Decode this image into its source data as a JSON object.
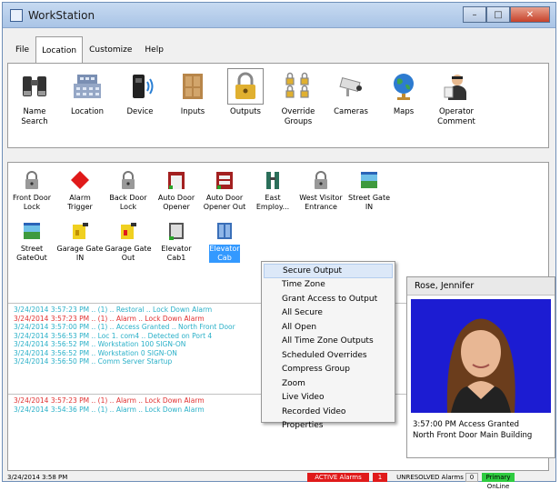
{
  "window": {
    "title": "WorkStation"
  },
  "menu": {
    "tabs": [
      "File",
      "Location",
      "Customize",
      "Help"
    ],
    "active": "Location"
  },
  "ribbon": {
    "items": [
      {
        "label": "Name\nSearch",
        "icon": "binoculars-icon"
      },
      {
        "label": "Location",
        "icon": "building-icon"
      },
      {
        "label": "Device",
        "icon": "device-icon"
      },
      {
        "label": "Inputs",
        "icon": "door-icon"
      },
      {
        "label": "Outputs",
        "icon": "padlock-icon"
      },
      {
        "label": "Override\nGroups",
        "icon": "lock-group-icon"
      },
      {
        "label": "Cameras",
        "icon": "camera-icon"
      },
      {
        "label": "Maps",
        "icon": "globe-icon"
      },
      {
        "label": "Operator\nComment",
        "icon": "operator-icon"
      }
    ]
  },
  "devices": [
    {
      "label": "Front Door\nLock",
      "icon": "lock-icon"
    },
    {
      "label": "Alarm\nTrigger",
      "icon": "alarm-diamond-icon"
    },
    {
      "label": "Back Door\nLock",
      "icon": "lock-icon"
    },
    {
      "label": "Auto Door\nOpener",
      "icon": "auto-door-icon"
    },
    {
      "label": "Auto Door\nOpener Out",
      "icon": "auto-door-icon"
    },
    {
      "label": "East\nEmploy...",
      "icon": "turnstile-icon"
    },
    {
      "label": "West Visitor\nEntrance",
      "icon": "lock-icon"
    },
    {
      "label": "Street Gate\nIN",
      "icon": "gate-icon"
    },
    {
      "label": "Street\nGateOut",
      "icon": "gate-icon"
    },
    {
      "label": "Garage Gate\nIN",
      "icon": "garage-gate-icon"
    },
    {
      "label": "Garage Gate\nOut",
      "icon": "garage-gate-icon"
    },
    {
      "label": "Elevator\nCab1",
      "icon": "elevator-icon"
    },
    {
      "label": "Elevator\nCab",
      "icon": "elevator-icon"
    }
  ],
  "log_top": [
    {
      "text": "3/24/2014 3:57:23 PM .. (1) .. Restoral .. Lock Down Alarm",
      "color": "cyan"
    },
    {
      "text": "3/24/2014 3:57:23 PM .. (1) .. Alarm .. Lock Down Alarm",
      "color": "red"
    },
    {
      "text": "3/24/2014 3:57:00 PM .. (1) .. Access Granted .. North Front Door",
      "color": "cyan"
    },
    {
      "text": "3/24/2014 3:56:53 PM .. Loc 1. com4 .. Detected on Port 4",
      "color": "cyan"
    },
    {
      "text": "3/24/2014 3:56:52 PM .. Workstation 100 SIGN-ON",
      "color": "cyan"
    },
    {
      "text": "3/24/2014 3:56:52 PM .. Workstation 0 SIGN-ON",
      "color": "cyan"
    },
    {
      "text": "3/24/2014 3:56:50 PM .. Comm Server Startup",
      "color": "cyan"
    }
  ],
  "log_bottom": [
    {
      "text": "3/24/2014 3:57:23 PM .. (1) .. Alarm .. Lock Down Alarm",
      "color": "red"
    },
    {
      "text": "3/24/2014 3:54:36 PM .. (1) .. Alarm .. Lock Down Alarm",
      "color": "cyan"
    }
  ],
  "context_menu": [
    "Secure Output",
    "Time Zone",
    "Grant Access to Output",
    "All Secure",
    "All Open",
    "All Time Zone Outputs",
    "Scheduled Overrides",
    "Compress Group",
    "Zoom",
    "Live Video",
    "Recorded Video",
    "Properties"
  ],
  "photo_panel": {
    "name": "Rose, Jennifer",
    "event_line1": "3:57:00 PM Access Granted",
    "event_line2": "North Front Door Main Building"
  },
  "status": {
    "datetime": "3/24/2014 3:58 PM",
    "active_alarms": "ACTIVE Alarms",
    "active_count": "1",
    "unresolved": "UNRESOLVED Alarms",
    "unresolved_count": "0",
    "online": "Primary OnLine"
  },
  "colors": {
    "red": "#e03030",
    "cyan": "#2ab0c8",
    "highlight": "#3399ff"
  }
}
